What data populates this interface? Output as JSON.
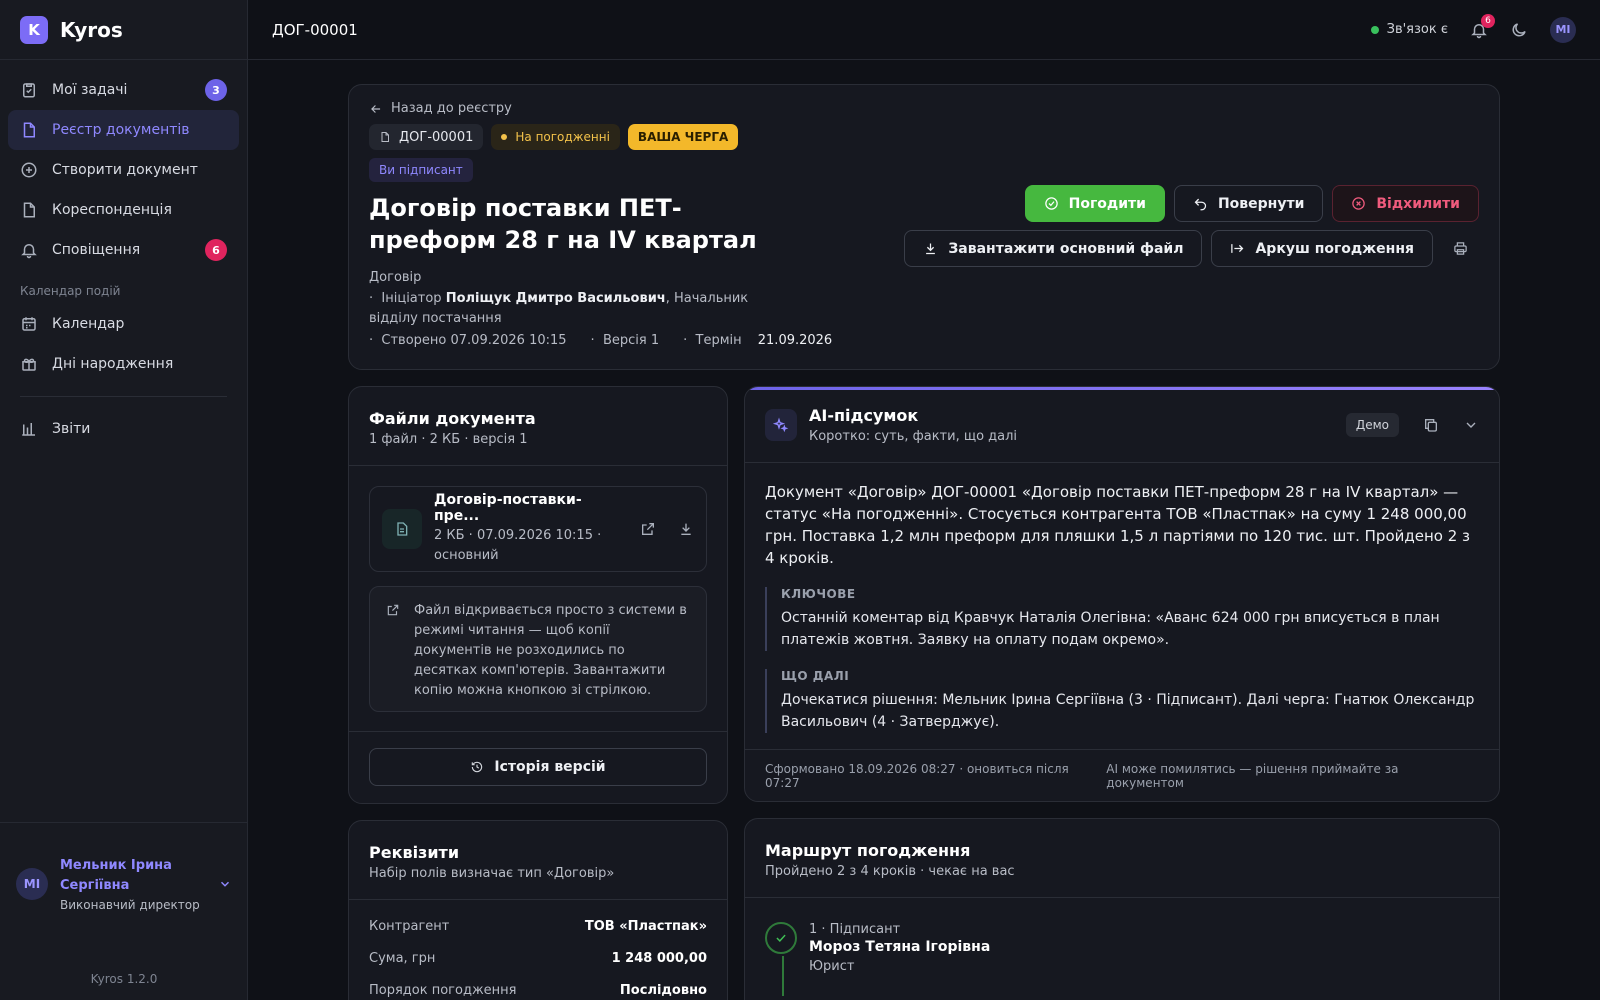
{
  "app": {
    "name": "Kyros",
    "logo_letter": "K",
    "version": "Kyros 1.2.0"
  },
  "sidebar": {
    "items": [
      {
        "label": "Мої задачі",
        "badge": "3",
        "icon": "clipboard-check-icon"
      },
      {
        "label": "Реєстр документів",
        "icon": "document-icon",
        "active": true
      },
      {
        "label": "Створити документ",
        "icon": "plus-circle-icon"
      },
      {
        "label": "Кореспонденція",
        "icon": "file-icon"
      },
      {
        "label": "Сповіщення",
        "badge": "6",
        "icon": "bell-icon"
      }
    ],
    "section_label": "Календар подій",
    "calendar_items": [
      {
        "label": "Календар",
        "icon": "calendar-icon"
      },
      {
        "label": "Дні народження",
        "icon": "gift-icon"
      }
    ],
    "reports": {
      "label": "Звіти",
      "icon": "bar-chart-icon"
    },
    "user": {
      "initials": "MI",
      "name": "Мельник Ірина Сергіївна",
      "role": "Виконавчий директор"
    }
  },
  "topbar": {
    "title": "ДОГ-00001",
    "connection": "Зв'язок є",
    "notifications": "6",
    "avatar": "MI"
  },
  "document": {
    "back_label": "Назад до реєстру",
    "id": "ДОГ-00001",
    "status": "На погодженні",
    "turn": "ВАША ЧЕРГА",
    "role_tag": "Ви підписант",
    "title": "Договір поставки ПЕТ-преформ 28 г на IV квартал",
    "type": "Договір",
    "initiator_prefix": "Ініціатор",
    "initiator_name": "Поліщук Дмитро Васильович",
    "initiator_role": ", Начальник відділу постачання",
    "created": "Створено 07.09.2026 10:15",
    "version": "Версія 1",
    "deadline_label": "Термін",
    "deadline": "21.09.2026"
  },
  "actions": {
    "approve": "Погодити",
    "return": "Повернути",
    "reject": "Відхилити",
    "download": "Завантажити основний файл",
    "sheet": "Аркуш погодження"
  },
  "files": {
    "title": "Файли документа",
    "subtitle": "1 файл · 2 КБ · версія 1",
    "file_name": "Договір-поставки-пре...",
    "file_meta": "2 КБ · 07.09.2026 10:15 · основний",
    "info": "Файл відкривається просто з системи в режимі читання — щоб копії документів не розходились по десятках комп'ютерів. Завантажити копію можна кнопкою зі стрілкою.",
    "history_button": "Історія версій"
  },
  "ai": {
    "title": "AI-підсумок",
    "subtitle": "Коротко: суть, факти, що далі",
    "demo": "Демо",
    "summary": "Документ «Договір» ДОГ-00001 «Договір поставки ПЕТ-преформ 28 г на IV квартал» — статус «На погодженні». Стосується контрагента ТОВ «Пластпак» на суму 1 248 000,00 грн. Поставка 1,2 млн преформ для пляшки 1,5 л партіями по 120 тис. шт. Пройдено 2 з 4 кроків.",
    "key_label": "КЛЮЧОВЕ",
    "key_text": "Останній коментар від Кравчук Наталія Олегівна: «Аванс 624 000 грн вписується в план платежів жовтня. Заявку на оплату подам окремо».",
    "next_label": "ЩО ДАЛІ",
    "next_text": "Дочекатися рішення: Мельник Ірина Сергіївна (3 · Підписант). Далі черга: Гнатюк Олександр Васильович (4 · Затверджує).",
    "generated": "Сформовано 18.09.2026 08:27 · оновиться після 07:27",
    "disclaimer": "AI може помилятись — рішення приймайте за документом"
  },
  "requisites": {
    "title": "Реквізити",
    "subtitle": "Набір полів визначає тип «Договір»",
    "rows": [
      {
        "key": "Контрагент",
        "value": "ТОВ «Пластпак»"
      },
      {
        "key": "Сума, грн",
        "value": "1 248 000,00"
      },
      {
        "key": "Порядок погодження",
        "value": "Послідовно"
      }
    ]
  },
  "route": {
    "title": "Маршрут погодження",
    "subtitle": "Пройдено 2 з 4 кроків · чекає на вас",
    "steps": [
      {
        "num": "1 · Підписант",
        "name": "Мороз Тетяна Ігорівна",
        "role": "Юрист"
      }
    ]
  },
  "colors": {
    "accent": "#7c6cf6",
    "approve": "#46b83f",
    "reject": "#f05b7d",
    "status": "#f3c24a"
  }
}
